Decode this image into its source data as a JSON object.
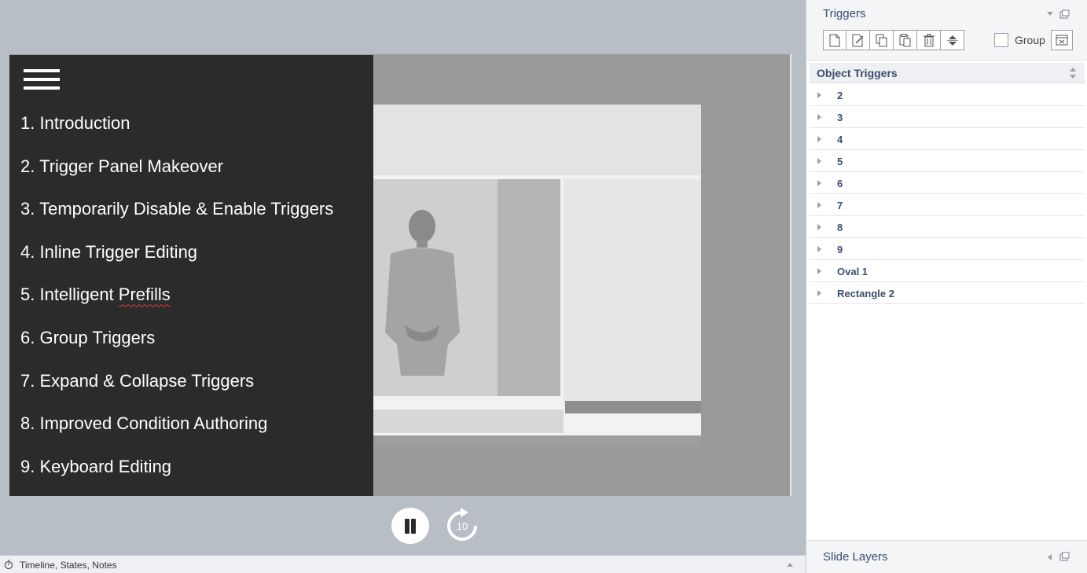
{
  "menu": {
    "items": [
      {
        "num": "1.",
        "label": "Introduction"
      },
      {
        "num": "2.",
        "label": "Trigger Panel Makeover"
      },
      {
        "num": "3.",
        "label": "Temporarily Disable & Enable Triggers"
      },
      {
        "num": "4.",
        "label": "Inline Trigger Editing"
      },
      {
        "num": "5.",
        "label": "Intelligent Prefills"
      },
      {
        "num": "6.",
        "label": "Group Triggers"
      },
      {
        "num": "7.",
        "label": "Expand & Collapse Triggers"
      },
      {
        "num": "8.",
        "label": "Improved Condition Authoring"
      },
      {
        "num": "9.",
        "label": "Keyboard Editing"
      }
    ]
  },
  "player": {
    "replay_seconds": "10",
    "pause_icon": "pause-icon",
    "replay_icon": "replay-10-icon"
  },
  "statusbar": {
    "label": "Timeline, States, Notes"
  },
  "triggers_panel": {
    "title": "Triggers",
    "group_label": "Group",
    "group_checked": false,
    "toolbar_icons": [
      "new-trigger-icon",
      "edit-trigger-icon",
      "copy-icon",
      "paste-icon",
      "delete-icon",
      "move-up-down-icon"
    ],
    "section_title": "Object Triggers",
    "items": [
      "2",
      "3",
      "4",
      "5",
      "6",
      "7",
      "8",
      "9",
      "Oval 1",
      "Rectangle 2"
    ],
    "footer_title": "Slide Layers"
  },
  "colors": {
    "canvas_bg": "#b8bec6",
    "menu_bg": "#2b2b2b",
    "panel_text": "#3a4e6b"
  }
}
